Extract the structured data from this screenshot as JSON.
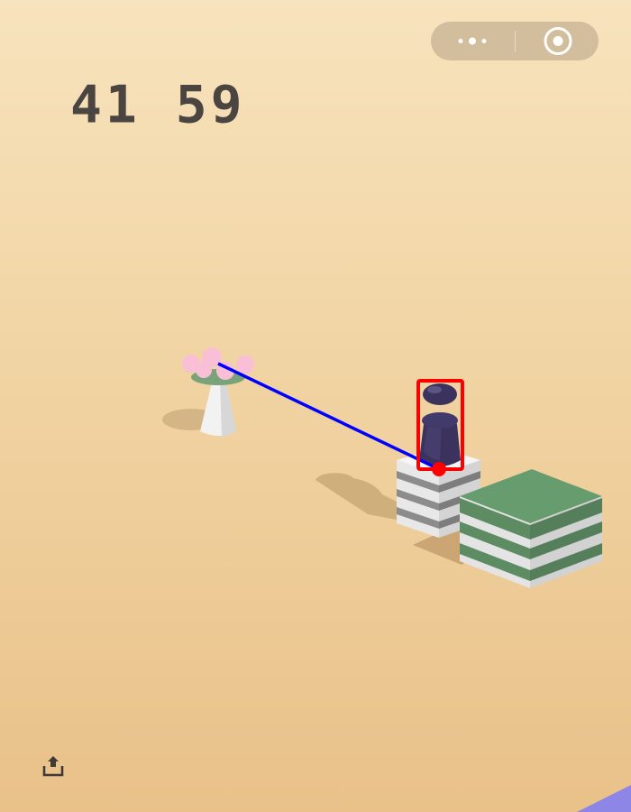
{
  "game": {
    "score": "41 59"
  },
  "topbar": {
    "menu_icon": "more-dots-icon",
    "close_icon": "target-circle-icon"
  },
  "footer": {
    "share_icon": "share-upload-icon"
  },
  "colors": {
    "background_top": "#f7e3bd",
    "background_bottom": "#e9c189",
    "score": "#4a4541",
    "aim_line": "#0000ff",
    "highlight_box": "#ff0000",
    "player": "#3b335e",
    "block_green": "#5f916a",
    "block_gray": "#8f8f8f",
    "flower_pink": "#f9bfd7"
  }
}
